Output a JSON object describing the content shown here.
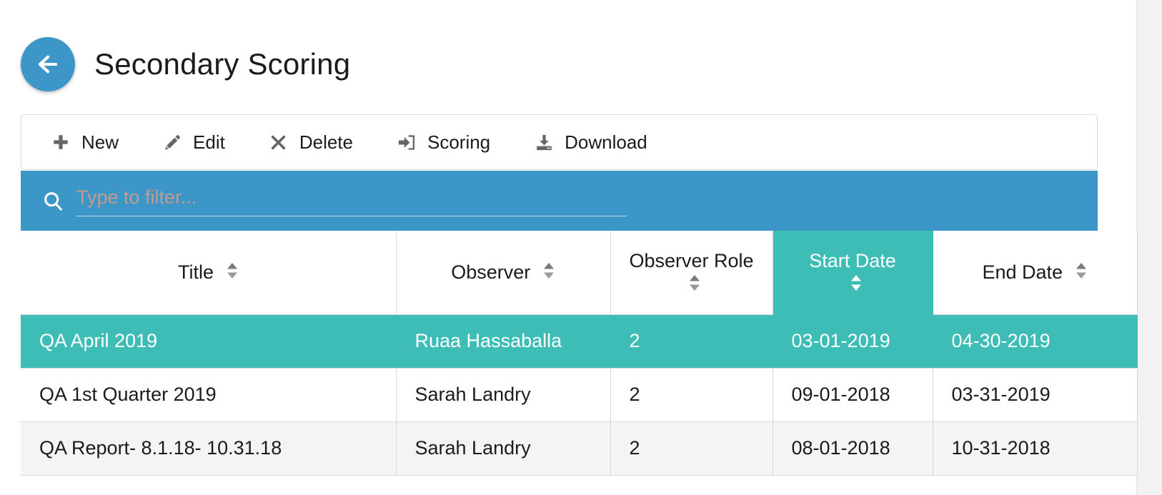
{
  "header": {
    "back_icon": "arrow-left-icon",
    "title": "Secondary Scoring"
  },
  "colors": {
    "accent_blue": "#3c96c8",
    "accent_teal": "#3ebcb6",
    "stripe": "#f4f4f4",
    "border": "#d8d8d8"
  },
  "toolbar": {
    "buttons": [
      {
        "label": "New",
        "icon": "plus-icon"
      },
      {
        "label": "Edit",
        "icon": "pencil-icon"
      },
      {
        "label": "Delete",
        "icon": "times-icon"
      },
      {
        "label": "Scoring",
        "icon": "sign-in-icon"
      },
      {
        "label": "Download",
        "icon": "download-tray-icon"
      }
    ]
  },
  "filter": {
    "icon": "search-icon",
    "value": "",
    "placeholder": "Type to filter..."
  },
  "table": {
    "columns": [
      {
        "label": "Title",
        "sorted": false,
        "sort_icon": "sort-updown-icon"
      },
      {
        "label": "Observer",
        "sorted": false,
        "sort_icon": "sort-updown-icon"
      },
      {
        "label": "Observer Role",
        "sorted": false,
        "sort_icon": "sort-updown-icon"
      },
      {
        "label": "Start Date",
        "sorted": true,
        "sort_icon": "sort-updown-icon"
      },
      {
        "label": "End Date",
        "sorted": false,
        "sort_icon": "sort-updown-icon"
      }
    ],
    "rows": [
      {
        "title": "QA April 2019",
        "observer": "Ruaa Hassaballa",
        "observer_role": "2",
        "start_date": "03-01-2019",
        "end_date": "04-30-2019",
        "selected": true,
        "striped": false
      },
      {
        "title": "QA 1st Quarter 2019",
        "observer": "Sarah Landry",
        "observer_role": "2",
        "start_date": "09-01-2018",
        "end_date": "03-31-2019",
        "selected": false,
        "striped": false
      },
      {
        "title": "QA Report- 8.1.18- 10.31.18",
        "observer": "Sarah Landry",
        "observer_role": "2",
        "start_date": "08-01-2018",
        "end_date": "10-31-2018",
        "selected": false,
        "striped": true
      }
    ]
  }
}
